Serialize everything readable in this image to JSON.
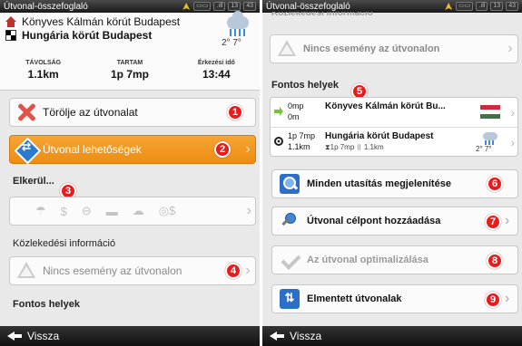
{
  "left": {
    "statusbar": {
      "title": "Útvonal-összefoglaló",
      "icons": [
        "gps-icon",
        "battery-icon",
        "signal-icon"
      ],
      "time_h": "13",
      "time_m": "43"
    },
    "summary": {
      "start": "Könyves Kálmán körút Budapest",
      "destination": "Hungária körút Budapest",
      "weather": {
        "icon": "cloud-rain-icon",
        "low": "2°",
        "high": "7°"
      },
      "stats": [
        {
          "label": "TÁVOLSÁG",
          "value": "1.1km"
        },
        {
          "label": "TARTAM",
          "value": "1p 7mp"
        },
        {
          "label": "Érkezési idő",
          "value": "13:44"
        }
      ]
    },
    "buttons": {
      "delete": {
        "label": "Törölje az útvonalat",
        "badge": "1"
      },
      "options": {
        "label": "Útvonal lehetőségek",
        "badge": "2"
      }
    },
    "avoid": {
      "title": "Elkerül...",
      "badge": "3",
      "icons": [
        "☂",
        "$",
        "⊖",
        "▬",
        "☁",
        "◎$"
      ]
    },
    "traffic": {
      "title": "Közlekedési információ",
      "label": "Nincs esemény az útvonalon",
      "badge": "4"
    },
    "places_title": "Fontos helyek",
    "back": "Vissza"
  },
  "right": {
    "statusbar": {
      "title": "Útvonal-összefoglaló",
      "overlap": "Közlekedési információ",
      "time_h": "13",
      "time_m": "43"
    },
    "traffic_label": "Nincs esemény az útvonalon",
    "places_title": "Fontos helyek",
    "places_badge": "5",
    "places": [
      {
        "time": "0mp",
        "dist": "0m",
        "name": "Könyves Kálmán körút Bu...",
        "sub": ""
      },
      {
        "time": "1p 7mp",
        "dist": "1.1km",
        "name": "Hungária körút Budapest",
        "sub": "⧗1p 7mp ▯ 1.1km",
        "low": "2°",
        "high": "7°"
      }
    ],
    "buttons": [
      {
        "label": "Minden utasítás megjelenítése",
        "badge": "6"
      },
      {
        "label": "Útvonal célpont hozzáadása",
        "badge": "7"
      },
      {
        "label": "Az útvonal optimalizálása",
        "badge": "8"
      },
      {
        "label": "Elmentett útvonalak",
        "badge": "9"
      }
    ],
    "back": "Vissza"
  },
  "colors": {
    "accent_orange": "#f29a22",
    "badge_red": "#e81c1c",
    "flag_red": "#cd2a3e",
    "flag_green": "#436f4d"
  }
}
